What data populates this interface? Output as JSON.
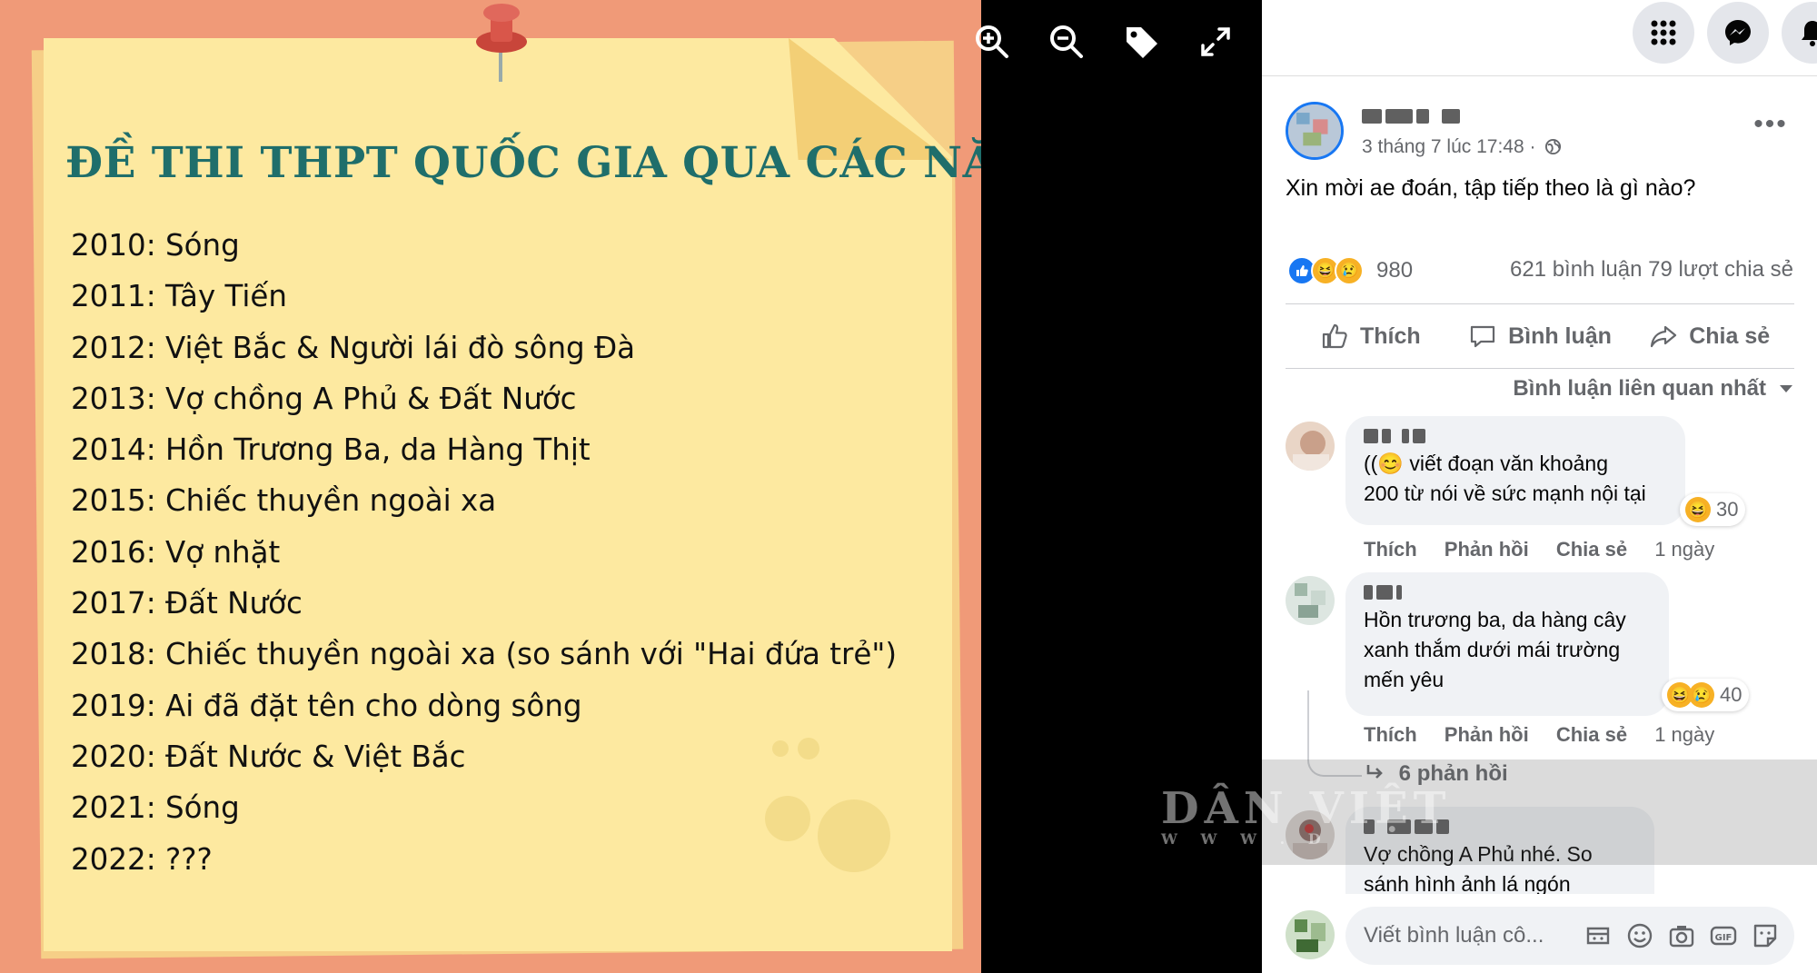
{
  "poster": {
    "title": "ĐỀ THI THPT QUỐC GIA QUA CÁC NĂM",
    "items": [
      "2010: Sóng",
      "2011: Tây Tiến",
      "2012: Việt Bắc & Người lái đò sông Đà",
      "2013: Vợ chồng A Phủ & Đất Nước",
      "2014: Hồn Trương Ba, da Hàng Thịt",
      "2015: Chiếc thuyền ngoài xa",
      "2016: Vợ nhặt",
      "2017: Đất Nước",
      "2018: Chiếc thuyền ngoài xa (so sánh với \"Hai đứa trẻ\")",
      "2019: Ai đã đặt tên cho dòng sông",
      "2020: Đất Nước & Việt Bắc",
      "2021: Sóng",
      "2022: ???"
    ]
  },
  "viewer_tools": [
    "zoom-in-icon",
    "zoom-out-icon",
    "tag-icon",
    "fullscreen-icon"
  ],
  "watermark": {
    "main": "DÂN VIỆT",
    "sub": "W W W . D"
  },
  "topbar_icons": [
    "menu-grid-icon",
    "messenger-icon",
    "notification-bell-icon"
  ],
  "post": {
    "meta": "3 tháng 7 lúc 17:48 ·",
    "text": "Xin mời ae đoán, tập tiếp theo là gì nào?",
    "reaction_count": "980",
    "stats": "621 bình luận  79 lượt chia sẻ",
    "actions": {
      "like": "Thích",
      "comment": "Bình luận",
      "share": "Chia sẻ"
    },
    "sort_label": "Bình luận liên quan nhất"
  },
  "comments": [
    {
      "lines": [
        "((😊 viết đoạn văn khoảng",
        "200 từ nói về sức mạnh nội tại"
      ],
      "reaction_count": "30",
      "actions": {
        "like": "Thích",
        "reply": "Phản hồi",
        "share": "Chia sẻ",
        "time": "1 ngày"
      }
    },
    {
      "lines": [
        "Hồn trương ba, da hàng cây",
        "xanh thắm dưới mái trường",
        "mến yêu"
      ],
      "reaction_count": "40",
      "actions": {
        "like": "Thích",
        "reply": "Phản hồi",
        "share": "Chia sẻ",
        "time": "1 ngày"
      }
    },
    {
      "lines": [
        "Vợ chồng A Phủ nhé. So",
        "sánh hình ảnh lá ngón"
      ]
    }
  ],
  "replies_link": "6 phản hồi",
  "comment_box": {
    "placeholder": "Viết bình luận cô..."
  },
  "colors": {
    "accent": "#1877f2",
    "poster_title": "#1f6e6b",
    "paper": "#fde9a0",
    "photo_bg": "#f09a78"
  }
}
